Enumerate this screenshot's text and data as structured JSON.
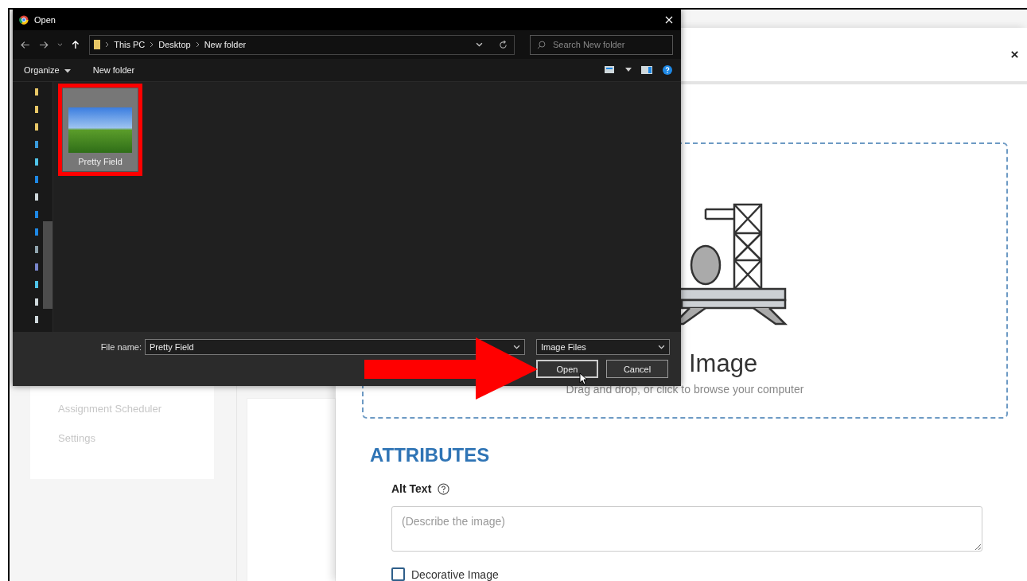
{
  "background_nav": {
    "items": [
      {
        "label": "Assignment Scheduler"
      },
      {
        "label": "Settings"
      }
    ]
  },
  "modal": {
    "dropzone": {
      "title": "Image",
      "hint": "Drag and drop, or click to browse your computer"
    },
    "section_title": "ATTRIBUTES",
    "alt_text": {
      "label": "Alt Text",
      "placeholder": "(Describe the image)"
    },
    "decorative": {
      "label": "Decorative Image",
      "checked": false
    }
  },
  "dialog": {
    "title": "Open",
    "breadcrumb": [
      "This PC",
      "Desktop",
      "New folder"
    ],
    "search": {
      "placeholder": "Search New folder"
    },
    "toolbar": [
      "Organize",
      "New folder"
    ],
    "files": [
      {
        "name": "Pretty Field",
        "selected": true
      }
    ],
    "file_name": {
      "label": "File name:",
      "value": "Pretty Field"
    },
    "file_type": "Image Files",
    "buttons": [
      "Open",
      "Cancel"
    ]
  }
}
